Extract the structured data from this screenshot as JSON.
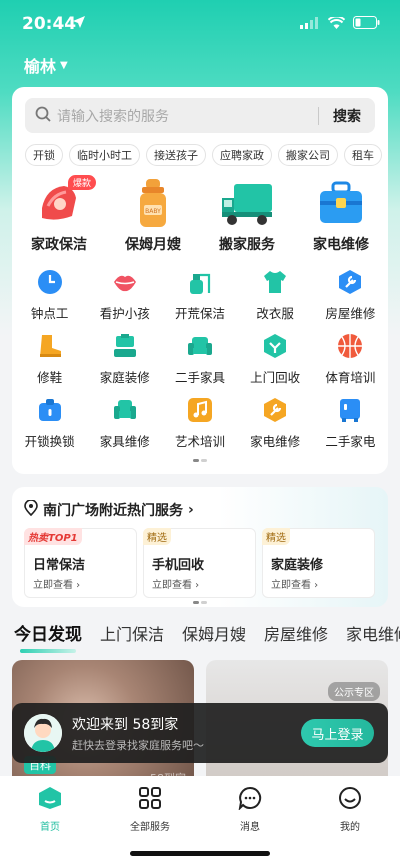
{
  "status": {
    "time": "20:44"
  },
  "location": {
    "city": "榆林"
  },
  "search": {
    "placeholder": "请输入搜索的服务",
    "button": "搜索"
  },
  "hot_tags": [
    "开锁",
    "临时小时工",
    "接送孩子",
    "应聘家政",
    "搬家公司",
    "租车"
  ],
  "main_services": [
    {
      "label": "家政保洁",
      "icon": "cleaning-cloth-icon",
      "badge": "爆款"
    },
    {
      "label": "保姆月嫂",
      "icon": "baby-bottle-icon",
      "bottle_text": "BABY"
    },
    {
      "label": "搬家服务",
      "icon": "moving-truck-icon"
    },
    {
      "label": "家电维修",
      "icon": "toolbox-icon"
    }
  ],
  "grid_services": [
    [
      {
        "label": "钟点工",
        "icon": "clock-icon",
        "color": "#2b8ef5"
      },
      {
        "label": "看护小孩",
        "icon": "lips-icon",
        "color": "#f05363"
      },
      {
        "label": "开荒保洁",
        "icon": "spray-bottle-icon",
        "color": "#22c4a6"
      },
      {
        "label": "改衣服",
        "icon": "shirt-icon",
        "color": "#22c4a6"
      },
      {
        "label": "房屋维修",
        "icon": "wrench-icon",
        "color": "#2b8ef5"
      }
    ],
    [
      {
        "label": "修鞋",
        "icon": "boot-icon",
        "color": "#f5a623"
      },
      {
        "label": "家庭装修",
        "icon": "paint-roller-icon",
        "color": "#22c4a6"
      },
      {
        "label": "二手家具",
        "icon": "sofa-icon",
        "color": "#22c4a6"
      },
      {
        "label": "上门回收",
        "icon": "recycle-icon",
        "color": "#22c4a6"
      },
      {
        "label": "体育培训",
        "icon": "basketball-icon",
        "color": "#f05a3c"
      }
    ],
    [
      {
        "label": "开锁换锁",
        "icon": "lock-icon",
        "color": "#2b8ef5"
      },
      {
        "label": "家具维修",
        "icon": "armchair-icon",
        "color": "#22c4a6"
      },
      {
        "label": "艺术培训",
        "icon": "music-note-icon",
        "color": "#f5a623"
      },
      {
        "label": "家电维修",
        "icon": "wrench-badge-icon",
        "color": "#f5a623"
      },
      {
        "label": "二手家电",
        "icon": "fridge-icon",
        "color": "#2b8ef5"
      }
    ]
  ],
  "nearby": {
    "title": "南门广场附近热门服务",
    "chevron": "›",
    "items": [
      {
        "badge": "热卖TOP1",
        "name": "日常保洁",
        "link": "立即查看 ›"
      },
      {
        "badge": "精选",
        "name": "手机回收",
        "link": "立即查看 ›"
      },
      {
        "badge": "精选",
        "name": "家庭装修",
        "link": "立即查看 ›"
      }
    ]
  },
  "discover_tabs": [
    "今日发现",
    "上门保洁",
    "保姆月嫂",
    "房屋维修",
    "家电维修"
  ],
  "feed": {
    "card1_tag": "百科",
    "card1_watermark": "58到家",
    "card2_tag": "公示专区"
  },
  "toast": {
    "title": "欢迎来到 58到家",
    "subtitle": "赶快去登录找家庭服务吧～",
    "button": "马上登录"
  },
  "tabbar": [
    {
      "label": "首页",
      "icon": "home-icon"
    },
    {
      "label": "全部服务",
      "icon": "grid-icon"
    },
    {
      "label": "消息",
      "icon": "message-icon"
    },
    {
      "label": "我的",
      "icon": "smile-icon"
    }
  ],
  "colors": {
    "accent": "#1fbe9f",
    "badge_red": "#ff4d4f"
  }
}
